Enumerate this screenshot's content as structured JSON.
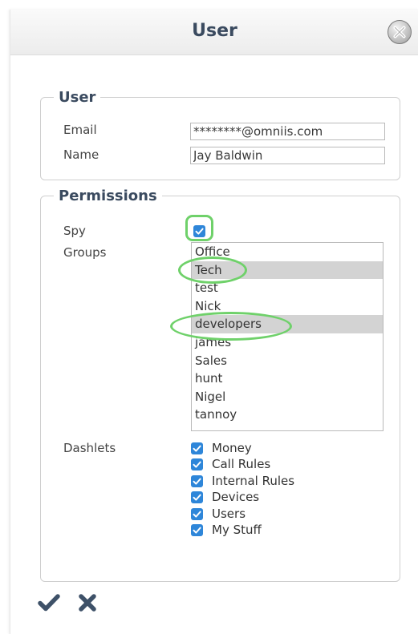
{
  "dialog": {
    "title": "User"
  },
  "user_section": {
    "legend": "User",
    "email_label": "Email",
    "email_value": "********@omniis.com",
    "name_label": "Name",
    "name_value": "Jay Baldwin"
  },
  "permissions": {
    "legend": "Permissions",
    "spy_label": "Spy",
    "spy_checked": true,
    "groups_label": "Groups",
    "groups": [
      {
        "label": "Office",
        "selected": false
      },
      {
        "label": "Tech",
        "selected": true
      },
      {
        "label": "test",
        "selected": false
      },
      {
        "label": "Nick",
        "selected": false
      },
      {
        "label": "developers",
        "selected": true
      },
      {
        "label": "james",
        "selected": false
      },
      {
        "label": "Sales",
        "selected": false
      },
      {
        "label": "hunt",
        "selected": false
      },
      {
        "label": "Nigel",
        "selected": false
      },
      {
        "label": "tannoy",
        "selected": false
      }
    ],
    "dashlets_label": "Dashlets",
    "dashlets": [
      {
        "label": "Money",
        "checked": true
      },
      {
        "label": "Call Rules",
        "checked": true
      },
      {
        "label": "Internal Rules",
        "checked": true
      },
      {
        "label": "Devices",
        "checked": true
      },
      {
        "label": "Users",
        "checked": true
      },
      {
        "label": "My Stuff",
        "checked": true
      }
    ]
  },
  "icons": {
    "close": "close-icon",
    "confirm": "checkmark-icon",
    "cancel": "cross-icon"
  },
  "colors": {
    "title_text": "#3a4a5f",
    "checkbox_blue": "#2e86d9",
    "highlight_green": "#6fd16a",
    "selected_row": "#d3d3d3"
  }
}
